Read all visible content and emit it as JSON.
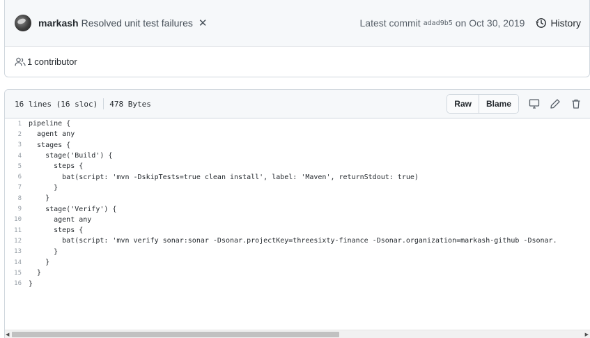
{
  "commit": {
    "author": "markash",
    "message": "Resolved unit test failures",
    "status_icon": "x-icon",
    "latest_label": "Latest commit",
    "sha": "adad9b5",
    "date_text": "on Oct 30, 2019",
    "history_label": "History"
  },
  "contributors": {
    "count": "1",
    "label": "contributor"
  },
  "file": {
    "lines_info": "16 lines (16 sloc)",
    "size": "478 Bytes",
    "raw_label": "Raw",
    "blame_label": "Blame",
    "icons": [
      "desktop-icon",
      "pencil-icon",
      "trash-icon"
    ]
  },
  "code": [
    {
      "n": "1",
      "t": "pipeline {"
    },
    {
      "n": "2",
      "t": "  agent any"
    },
    {
      "n": "3",
      "t": "  stages {"
    },
    {
      "n": "4",
      "t": "    stage('Build') {"
    },
    {
      "n": "5",
      "t": "      steps {"
    },
    {
      "n": "6",
      "t": "        bat(script: 'mvn -DskipTests=true clean install', label: 'Maven', returnStdout: true)"
    },
    {
      "n": "7",
      "t": "      }"
    },
    {
      "n": "8",
      "t": "    }"
    },
    {
      "n": "9",
      "t": "    stage('Verify') {"
    },
    {
      "n": "10",
      "t": "      agent any"
    },
    {
      "n": "11",
      "t": "      steps {"
    },
    {
      "n": "12",
      "t": "        bat(script: 'mvn verify sonar:sonar -Dsonar.projectKey=threesixty-finance -Dsonar.organization=markash-github -Dsonar."
    },
    {
      "n": "13",
      "t": "      }"
    },
    {
      "n": "14",
      "t": "    }"
    },
    {
      "n": "15",
      "t": "  }"
    },
    {
      "n": "16",
      "t": "}"
    }
  ]
}
